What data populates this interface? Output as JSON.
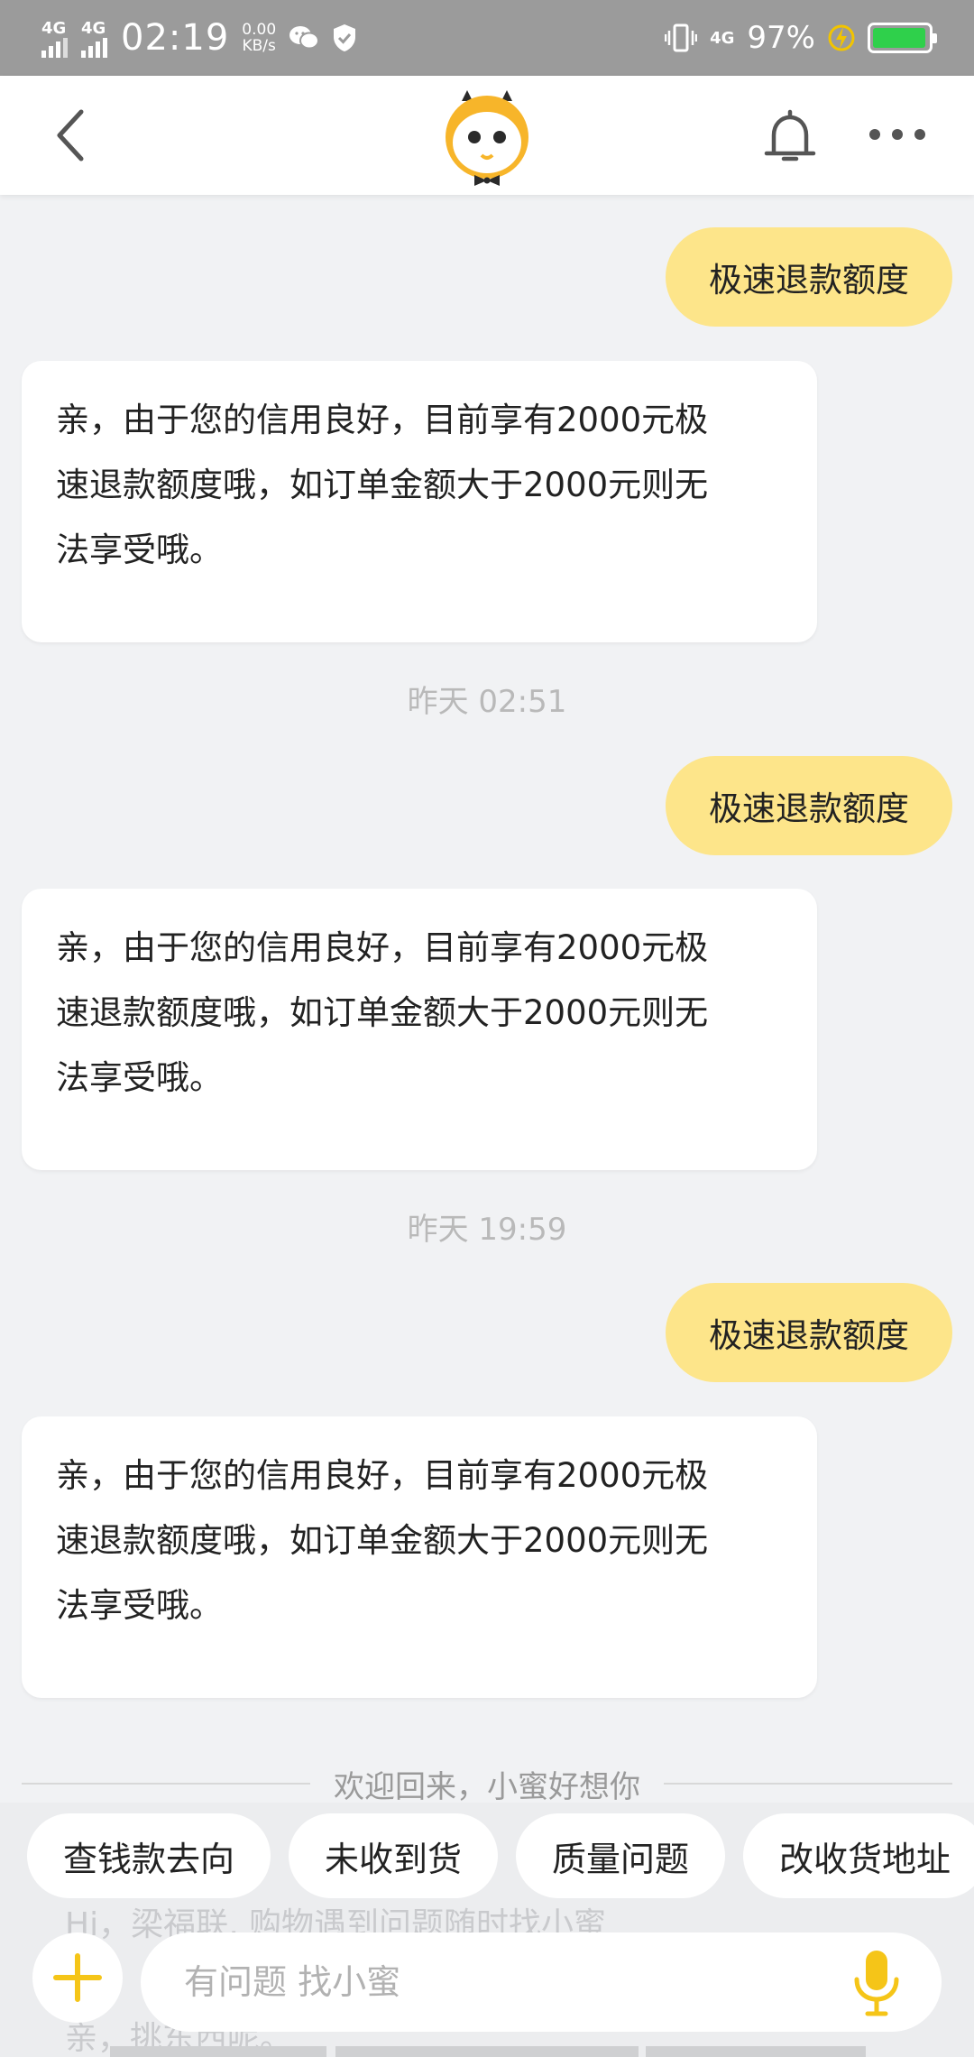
{
  "status_bar": {
    "time": "02:19",
    "net_speed_value": "0.00",
    "net_speed_unit": "KB/s",
    "signal_label_1": "4G",
    "signal_label_2": "4G",
    "mobile_label": "4G",
    "battery_percent": "97%",
    "battery_level": 0.97,
    "battery_color": "#2fd04b"
  },
  "nav": {
    "back_icon": "chevron-left-icon",
    "logo_icon": "mascot-logo-icon",
    "bell_icon": "bell-icon",
    "more_icon": "more-dots-icon"
  },
  "messages": [
    {
      "type": "user",
      "text": "极速退款额度"
    },
    {
      "type": "bot",
      "lines": [
        "亲，由于您的信用良好，目前享有2000元极",
        "速退款额度哦，如订单金额大于2000元则无",
        "法享受哦。"
      ]
    },
    {
      "type": "time",
      "text": "昨天 02:51"
    },
    {
      "type": "user",
      "text": "极速退款额度"
    },
    {
      "type": "bot",
      "lines": [
        "亲，由于您的信用良好，目前享有2000元极",
        "速退款额度哦，如订单金额大于2000元则无",
        "法享受哦。"
      ]
    },
    {
      "type": "time",
      "text": "昨天 19:59"
    },
    {
      "type": "user",
      "text": "极速退款额度"
    },
    {
      "type": "bot",
      "lines": [
        "亲，由于您的信用良好，目前享有2000元极",
        "速退款额度哦，如订单金额大于2000元则无",
        "法享受哦。"
      ]
    }
  ],
  "welcome": "欢迎回来，小蜜好想你",
  "quick_actions": [
    "查钱款去向",
    "未收到货",
    "质量问题",
    "改收货地址"
  ],
  "ghost_lines": [
    "Hi，梁福联, 购物遇到问题随时找小蜜",
    "亲，挑东西呢。"
  ],
  "input": {
    "placeholder": "有问题 找小蜜",
    "value": ""
  },
  "colors": {
    "accent": "#f5c518",
    "user_bubble": "#fde58a",
    "background": "#f1f2f4"
  }
}
